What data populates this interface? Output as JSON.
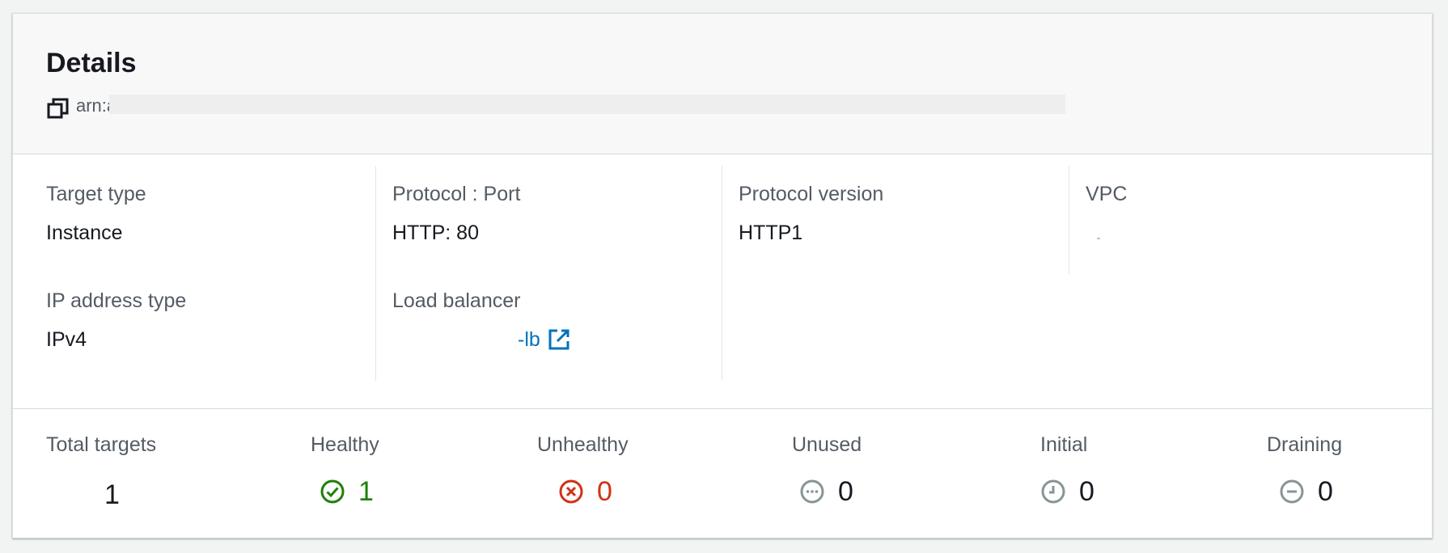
{
  "header": {
    "title": "Details",
    "arn_prefix": "arn:a"
  },
  "properties": {
    "target_type": {
      "label": "Target type",
      "value": "Instance"
    },
    "protocol_port": {
      "label": "Protocol : Port",
      "value": "HTTP: 80"
    },
    "protocol_version": {
      "label": "Protocol version",
      "value": "HTTP1"
    },
    "vpc": {
      "label": "VPC",
      "value": ""
    },
    "ip_address_type": {
      "label": "IP address type",
      "value": "IPv4"
    },
    "load_balancer": {
      "label": "Load balancer",
      "value": "-lb"
    }
  },
  "counts": {
    "total": {
      "label": "Total targets",
      "value": "1"
    },
    "healthy": {
      "label": "Healthy",
      "value": "1",
      "color": "#1d8102"
    },
    "unhealthy": {
      "label": "Unhealthy",
      "value": "0",
      "color": "#d13212"
    },
    "unused": {
      "label": "Unused",
      "value": "0",
      "color": "#879596"
    },
    "initial": {
      "label": "Initial",
      "value": "0",
      "color": "#879596"
    },
    "draining": {
      "label": "Draining",
      "value": "0",
      "color": "#879596"
    }
  },
  "icons": {
    "copy": "copy-icon",
    "external_link": "external-link-icon",
    "healthy": "check-circle-icon",
    "unhealthy": "x-circle-icon",
    "unused": "ellipsis-circle-icon",
    "initial": "clock-icon",
    "draining": "minus-circle-icon"
  }
}
